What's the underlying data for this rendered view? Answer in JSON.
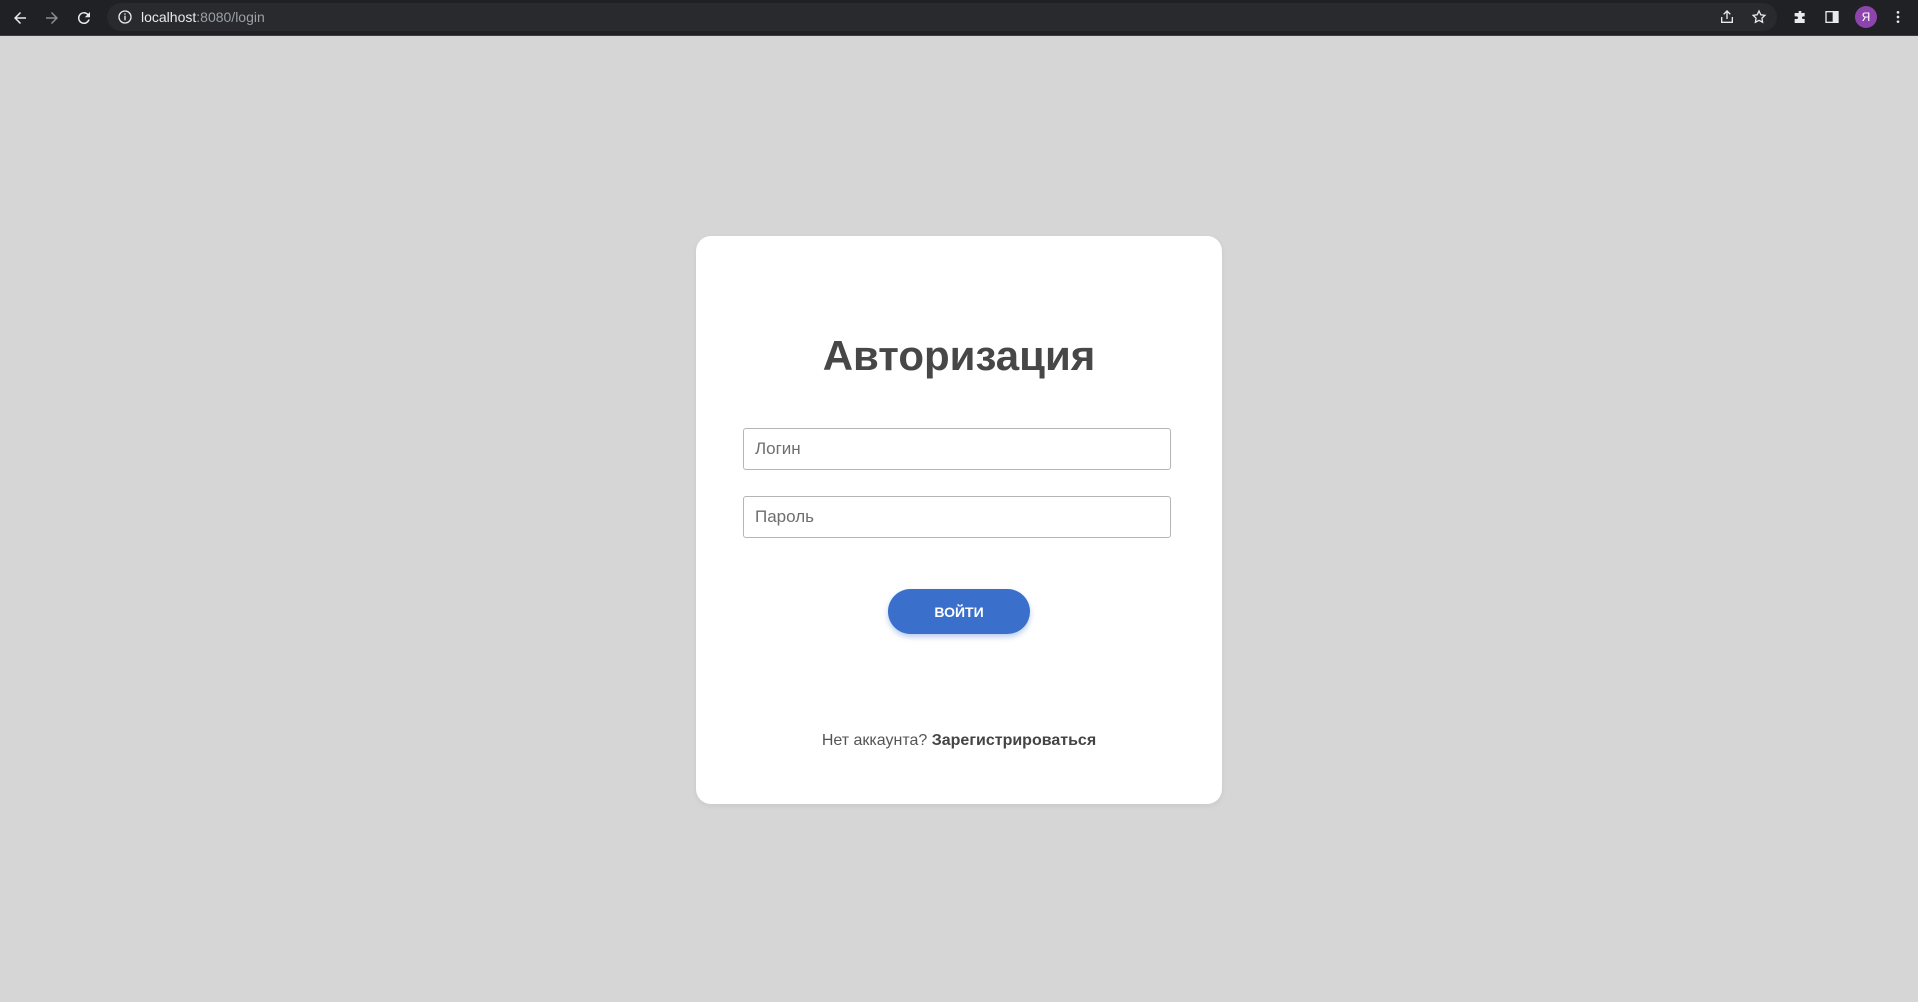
{
  "browser": {
    "url_host": "localhost",
    "url_rest": ":8080/login",
    "profile_initial": "Я"
  },
  "login": {
    "title": "Авторизация",
    "login_placeholder": "Логин",
    "password_placeholder": "Пароль",
    "submit_label": "ВОЙТИ",
    "no_account_text": "Нет аккаунта?",
    "register_link": "Зарегистрироваться"
  },
  "colors": {
    "page_bg": "#d6d6d6",
    "accent": "#3a70cb",
    "title_text": "#474747",
    "avatar_bg": "#8e44ad"
  }
}
